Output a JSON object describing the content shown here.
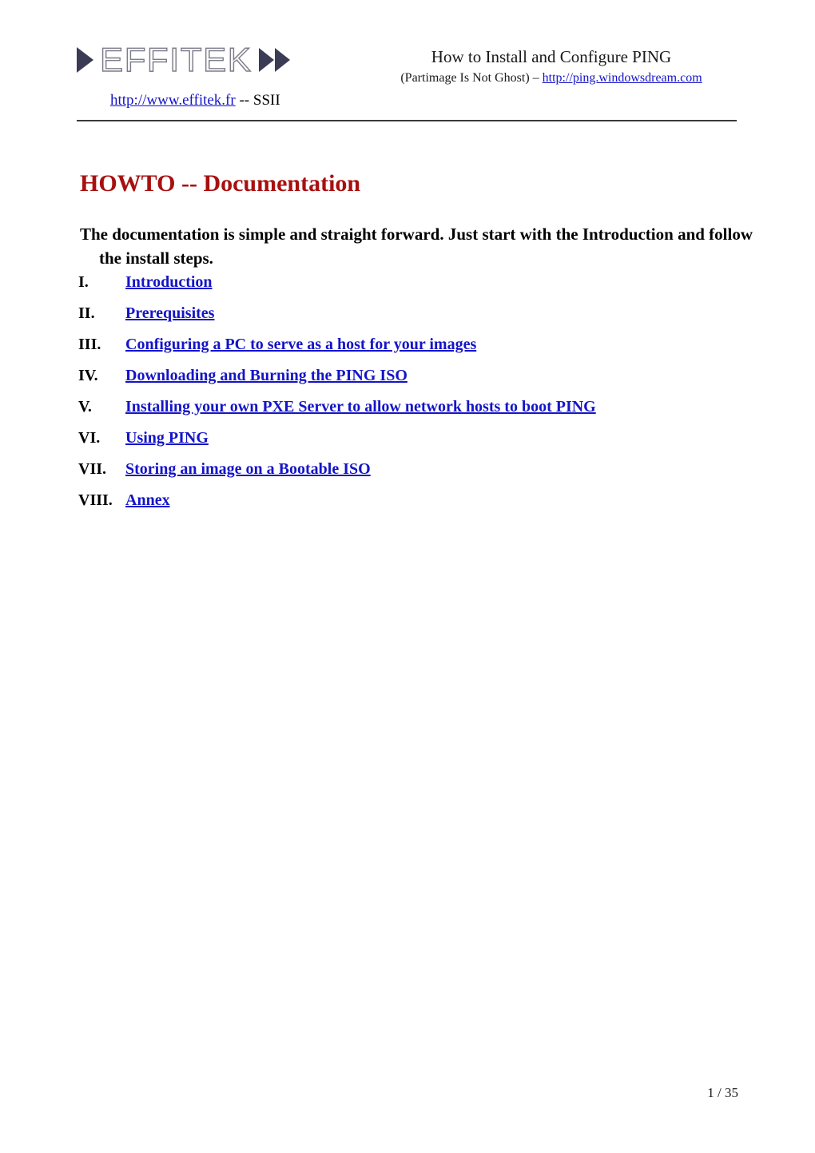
{
  "document": {
    "header": {
      "logo": {
        "wordmark": "EFFITEK",
        "site_url": "http://www.effitek.fr",
        "site_suffix": " -- SSII"
      },
      "title": "How to Install and Configure PING",
      "subtitle_prefix": "(Partimage Is Not Ghost) – ",
      "subtitle_url": "http://ping.windowsdream.com"
    },
    "title": "HOWTO -- Documentation",
    "intro": "The documentation is simple and straight forward. Just start with the Introduction and follow the install steps.",
    "toc": [
      {
        "numeral": "I.",
        "label": "Introduction"
      },
      {
        "numeral": "II.",
        "label": "Prerequisites"
      },
      {
        "numeral": "III.",
        "label": "Configuring a PC to serve as a host for your images"
      },
      {
        "numeral": "IV.",
        "label": "Downloading and Burning the PING ISO"
      },
      {
        "numeral": "V.",
        "label": "Installing your own PXE Server to allow network hosts to boot PING"
      },
      {
        "numeral": "VI.",
        "label": "Using PING"
      },
      {
        "numeral": "VII.",
        "label": "Storing an image on a Bootable ISO"
      },
      {
        "numeral": "VIII.",
        "label": "Annex"
      }
    ],
    "footer": {
      "page_indicator": "1 / 35"
    },
    "colors": {
      "title_red": "#a81010",
      "link_blue": "#1414c8",
      "logo_navy": "#3b3b55",
      "logo_gray": "#7d7d8a",
      "rule_gray": "#3a3a3a",
      "page_background": "#ffffff"
    }
  }
}
